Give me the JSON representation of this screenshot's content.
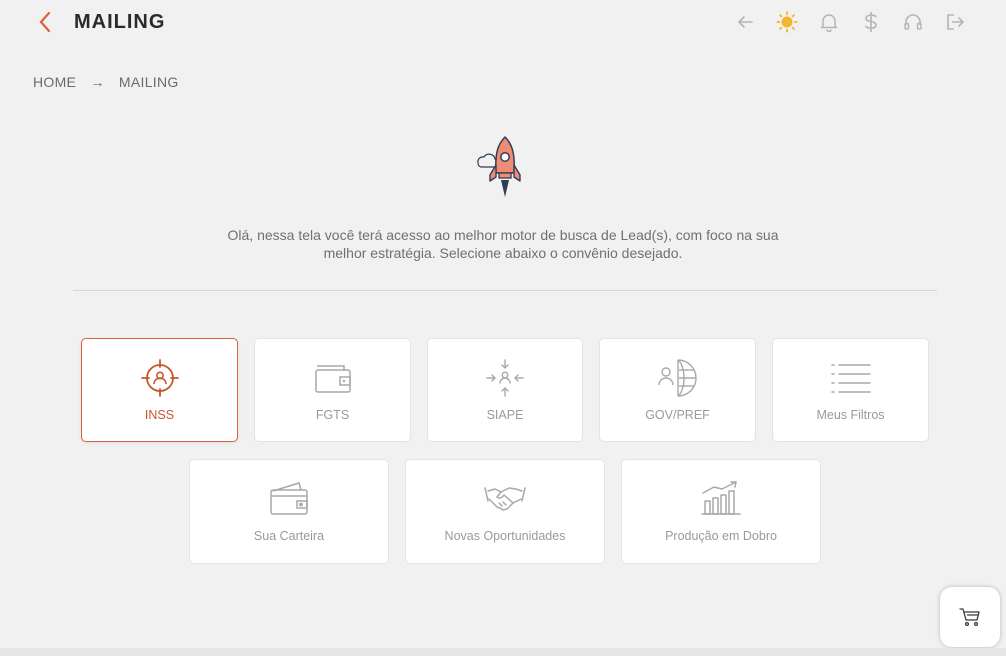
{
  "header": {
    "title": "MAILING",
    "actions": [
      "arrow-left-icon",
      "sun-icon",
      "bell-icon",
      "dollar-icon",
      "headset-icon",
      "logout-icon"
    ],
    "accent": "#d9643c"
  },
  "breadcrumb": {
    "home": "HOME",
    "separator": "→",
    "current": "MAILING"
  },
  "intro": {
    "line1": "Olá, nessa tela você terá acesso ao melhor motor de busca de Lead(s), com foco na sua",
    "line2": "melhor estratégia. Selecione abaixo o convênio desejado."
  },
  "cards_row1": [
    {
      "label": "INSS",
      "icon": "target-person-icon",
      "active": true
    },
    {
      "label": "FGTS",
      "icon": "wallet-icon",
      "active": false
    },
    {
      "label": "SIAPE",
      "icon": "focus-person-icon",
      "active": false
    },
    {
      "label": "GOV/PREF",
      "icon": "person-globe-icon",
      "active": false
    },
    {
      "label": "Meus Filtros",
      "icon": "list-icon",
      "active": false
    }
  ],
  "cards_row2": [
    {
      "label": "Sua Carteira",
      "icon": "wallet-card-icon"
    },
    {
      "label": "Novas Oportunidades",
      "icon": "handshake-icon"
    },
    {
      "label": "Produção em Dobro",
      "icon": "growth-chart-icon"
    }
  ],
  "cart": {
    "icon": "cart-icon"
  }
}
